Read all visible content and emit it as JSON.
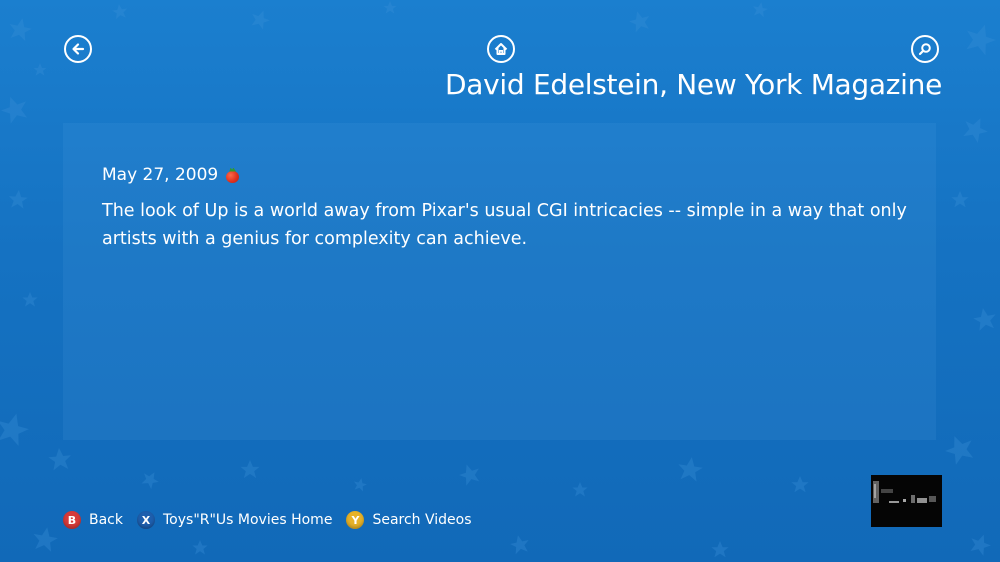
{
  "header": {
    "title": "David Edelstein, New York Magazine"
  },
  "nav": {
    "back_icon": "back-arrow-icon",
    "home_icon": "home-icon",
    "search_icon": "search-icon"
  },
  "review": {
    "date": "May 27, 2009",
    "rating_icon": "fresh-tomato-icon",
    "quote": "The look of Up is a world away from Pixar's usual CGI intricacies -- simple in a way that only artists with a genius for complexity can achieve."
  },
  "legend": {
    "items": [
      {
        "button": "B",
        "label": "Back",
        "color": "#d63a3a"
      },
      {
        "button": "X",
        "label": "Toys\"R\"Us Movies Home",
        "color": "#1e5fae"
      },
      {
        "button": "Y",
        "label": "Search Videos",
        "color": "#e7b228"
      }
    ]
  },
  "colors": {
    "background": "#1572c2",
    "text": "#ffffff"
  }
}
